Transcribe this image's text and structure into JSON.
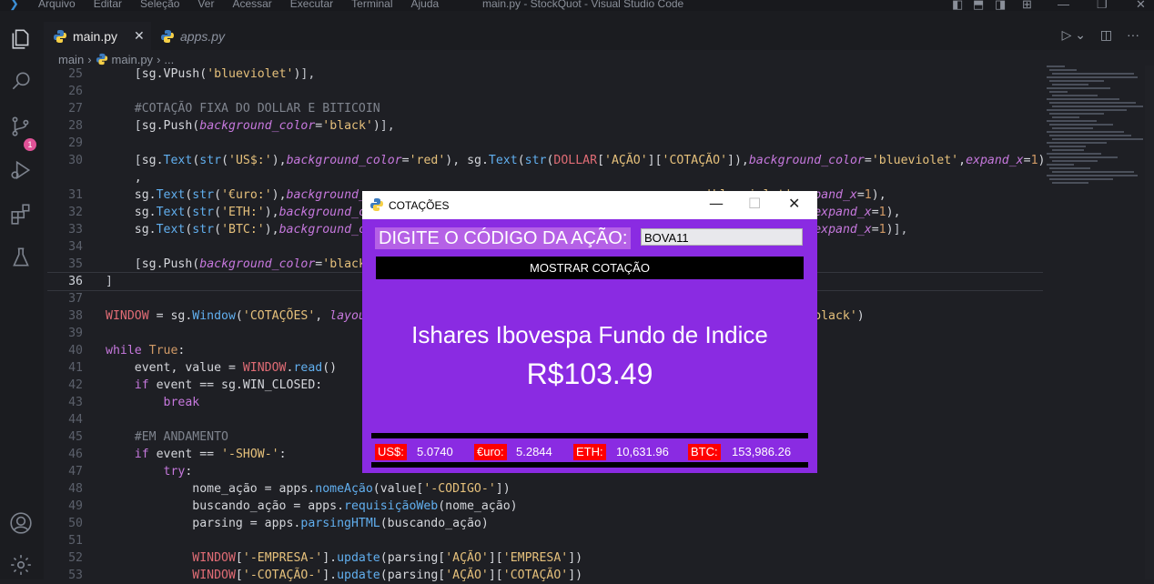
{
  "titlebar": {
    "menu": [
      "Arquivo",
      "Editar",
      "Seleção",
      "Ver",
      "Acessar",
      "Executar",
      "Terminal",
      "Ajuda"
    ],
    "window_title": "main.py - StockQuot - Visual Studio Code"
  },
  "activity": {
    "source_control_badge": "1"
  },
  "tabs": [
    {
      "label": "main.py",
      "close": "✕"
    },
    {
      "label": "apps.py"
    }
  ],
  "breadcrumb": {
    "folder": "main",
    "file": "main.py",
    "more": "..."
  },
  "code": {
    "lines": [
      {
        "n": "25",
        "html": "    <span class='o'>[</span>sg.VPush(<span class='s'>'blueviolet'</span>)<span class='o'>],</span>"
      },
      {
        "n": "26",
        "html": ""
      },
      {
        "n": "27",
        "html": "    <span class='c'>#COTAÇÃO FIXA DO DOLLAR E BITICOIN</span>"
      },
      {
        "n": "28",
        "html": "    <span class='o'>[</span>sg.Push(<span class='pr'>background_color</span>=<span class='s'>'black'</span>)<span class='o'>],</span>"
      },
      {
        "n": "29",
        "html": ""
      },
      {
        "n": "30",
        "html": "    <span class='o'>[</span>sg.<span class='f'>Text</span>(<span class='f'>str</span>(<span class='s'>'US$:'</span>),<span class='pr'>background_color</span>=<span class='s'>'red'</span>), sg.<span class='f'>Text</span>(<span class='f'>str</span>(<span class='p'>DOLLAR</span>[<span class='s'>'AÇÃO'</span>][<span class='s'>'COTAÇÃO'</span>]),<span class='pr'>background_color</span>=<span class='s'>'blueviolet'</span>,<span class='pr'>expand_x</span>=<span class='n'>1</span>)"
      },
      {
        "n": "",
        "html": "    ,"
      },
      {
        "n": "31",
        "html": "    sg.<span class='f'>Text</span>(<span class='f'>str</span>(<span class='s'>'€uro:'</span>),<span class='pr'>background_co</span>                                          <span class='pr'>or</span>=<span class='s'>'blueviolet'</span>,<span class='pr'>expand_x</span>=<span class='n'>1</span>),"
      },
      {
        "n": "32",
        "html": "    sg.<span class='f'>Text</span>(<span class='f'>str</span>(<span class='s'>'ETH:'</span>),<span class='pr'>background_co</span>                                           <span class='pr'>olor</span>=<span class='s'>'blueviolet'</span>,<span class='pr'>expand_x</span>=<span class='n'>1</span>),"
      },
      {
        "n": "33",
        "html": "    sg.<span class='f'>Text</span>(<span class='f'>str</span>(<span class='s'>'BTC:'</span>),<span class='pr'>background_co</span>                                           <span class='pr'>olor</span>=<span class='s'>'blueviolet'</span>,<span class='pr'>expand_x</span>=<span class='n'>1</span>)<span class='o'>],</span>"
      },
      {
        "n": "34",
        "html": ""
      },
      {
        "n": "35",
        "html": "    <span class='o'>[</span>sg.Push(<span class='pr'>background_color</span>=<span class='s'>'black'</span>"
      },
      {
        "n": "36",
        "html": "<span class='o'>]</span>",
        "current": true
      },
      {
        "n": "37",
        "html": ""
      },
      {
        "n": "38",
        "html": "<span class='p'>WINDOW</span> = sg.<span class='f'>Window</span>(<span class='s'>'COTAÇÕES'</span>, <span class='pr'>layout</span>                                                       <span class='pr'>olor</span>=<span class='s'>'black'</span>)"
      },
      {
        "n": "39",
        "html": ""
      },
      {
        "n": "40",
        "html": "<span class='k'>while</span> <span class='n'>True</span>:"
      },
      {
        "n": "41",
        "html": "    event, value = <span class='p'>WINDOW</span>.<span class='f'>read</span>()"
      },
      {
        "n": "42",
        "html": "    <span class='k'>if</span> event == sg.WIN_CLOSED:"
      },
      {
        "n": "43",
        "html": "        <span class='k'>break</span>"
      },
      {
        "n": "44",
        "html": ""
      },
      {
        "n": "45",
        "html": "    <span class='c'>#EM ANDAMENTO</span>"
      },
      {
        "n": "46",
        "html": "    <span class='k'>if</span> event == <span class='s'>'-SHOW-'</span>:"
      },
      {
        "n": "47",
        "html": "        <span class='k'>try</span>:"
      },
      {
        "n": "48",
        "html": "            nome_ação = apps.<span class='f'>nomeAção</span>(value[<span class='s'>'-CODIGO-'</span>])"
      },
      {
        "n": "49",
        "html": "            buscando_ação = apps.<span class='f'>requisiçãoWeb</span>(nome_ação)"
      },
      {
        "n": "50",
        "html": "            parsing = apps.<span class='f'>parsingHTML</span>(buscando_ação)"
      },
      {
        "n": "51",
        "html": ""
      },
      {
        "n": "52",
        "html": "            <span class='p'>WINDOW</span>[<span class='s'>'-EMPRESA-'</span>].<span class='f'>update</span>(parsing[<span class='s'>'AÇÃO'</span>][<span class='s'>'EMPRESA'</span>])"
      },
      {
        "n": "53",
        "html": "            <span class='p'>WINDOW</span>[<span class='s'>'-COTAÇÃO-'</span>].<span class='f'>update</span>(parsing[<span class='s'>'AÇÃO'</span>][<span class='s'>'COTAÇÃO'</span>])"
      }
    ]
  },
  "popup": {
    "title": "COTAÇÕES",
    "prompt_label": "DIGITE O CÓDIGO DA AÇÃO:",
    "code_input_value": "BOVA11",
    "show_button": "MOSTRAR COTAÇÃO",
    "company": "Ishares Ibovespa Fundo de Indice",
    "price": "R$103.49",
    "quotes": {
      "usd_label": "US$:",
      "usd_value": "5.0740",
      "eur_label": "€uro:",
      "eur_value": "5.2844",
      "eth_label": "ETH:",
      "eth_value": "10,631.96",
      "btc_label": "BTC:",
      "btc_value": "153,986.26"
    },
    "colors": {
      "background": "#8a2be2",
      "label_bg": "#ff0000",
      "button_bg": "#000000"
    }
  }
}
